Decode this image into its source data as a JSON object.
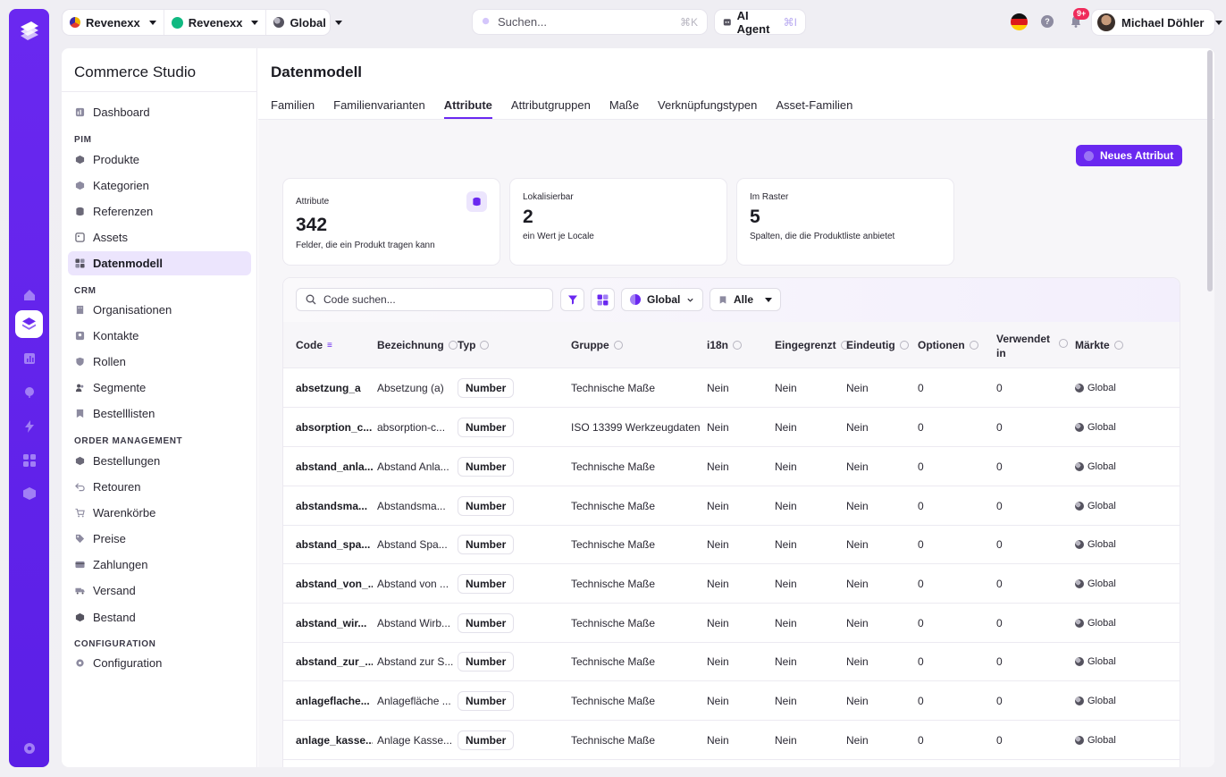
{
  "topbar": {
    "tenant1": "Revenexx",
    "tenant2": "Revenexx",
    "scope": "Global",
    "search_placeholder": "Suchen...",
    "search_shortcut": "⌘K",
    "ai_agent_label": "AI Agent",
    "ai_agent_shortcut": "⌘I",
    "help_glyph": "?",
    "notification_badge": "9+",
    "user_name": "Michael Döhler"
  },
  "sidebar": {
    "title": "Commerce Studio",
    "dashboard": "Dashboard",
    "sections": [
      {
        "title": "PIM",
        "items": [
          "Produkte",
          "Kategorien",
          "Referenzen",
          "Assets",
          "Datenmodell"
        ]
      },
      {
        "title": "CRM",
        "items": [
          "Organisationen",
          "Kontakte",
          "Rollen",
          "Segmente",
          "Bestelllisten"
        ]
      },
      {
        "title": "ORDER MANAGEMENT",
        "items": [
          "Bestellungen",
          "Retouren",
          "Warenkörbe",
          "Preise",
          "Zahlungen",
          "Versand",
          "Bestand"
        ]
      },
      {
        "title": "CONFIGURATION",
        "items": [
          "Configuration"
        ]
      }
    ],
    "active_item": "Datenmodell"
  },
  "main": {
    "title": "Datenmodell",
    "tabs": [
      "Familien",
      "Familienvarianten",
      "Attribute",
      "Attributgruppen",
      "Maße",
      "Verknüpfungstypen",
      "Asset-Familien"
    ],
    "active_tab": "Attribute",
    "new_button": "Neues Attribut",
    "cards": [
      {
        "label": "Attribute",
        "value": "342",
        "sub": "Felder, die ein Produkt tragen kann"
      },
      {
        "label": "Lokalisierbar",
        "value": "2",
        "sub": "ein Wert je Locale"
      },
      {
        "label": "Im Raster",
        "value": "5",
        "sub": "Spalten, die die Produktliste anbietet"
      }
    ],
    "filters": {
      "code_search_placeholder": "Code suchen...",
      "scope": "Global",
      "all": "Alle"
    },
    "table": {
      "headers": [
        "Code",
        "Bezeichnung",
        "Typ",
        "Gruppe",
        "i18n",
        "Eingegrenzt",
        "Eindeutig",
        "Optionen",
        "Verwendet in",
        "Märkte"
      ],
      "headers_split": {
        "used_line1": "Verwendet",
        "used_line2": "in"
      },
      "rows": [
        [
          "absetzung_a",
          "Absetzung (a)",
          "Number",
          "Technische Maße",
          "Nein",
          "Nein",
          "Nein",
          "0",
          "0",
          "Global"
        ],
        [
          "absorption_c...",
          "absorption-c...",
          "Number",
          "ISO 13399 Werkzeugdaten",
          "Nein",
          "Nein",
          "Nein",
          "0",
          "0",
          "Global"
        ],
        [
          "abstand_anla...",
          "Abstand Anla...",
          "Number",
          "Technische Maße",
          "Nein",
          "Nein",
          "Nein",
          "0",
          "0",
          "Global"
        ],
        [
          "abstandsma...",
          "Abstandsma...",
          "Number",
          "Technische Maße",
          "Nein",
          "Nein",
          "Nein",
          "0",
          "0",
          "Global"
        ],
        [
          "abstand_spa...",
          "Abstand Spa...",
          "Number",
          "Technische Maße",
          "Nein",
          "Nein",
          "Nein",
          "0",
          "0",
          "Global"
        ],
        [
          "abstand_von_...",
          "Abstand von ...",
          "Number",
          "Technische Maße",
          "Nein",
          "Nein",
          "Nein",
          "0",
          "0",
          "Global"
        ],
        [
          "abstand_wir...",
          "Abstand Wirb...",
          "Number",
          "Technische Maße",
          "Nein",
          "Nein",
          "Nein",
          "0",
          "0",
          "Global"
        ],
        [
          "abstand_zur_...",
          "Abstand zur S...",
          "Number",
          "Technische Maße",
          "Nein",
          "Nein",
          "Nein",
          "0",
          "0",
          "Global"
        ],
        [
          "anlageflache...",
          "Anlagefläche ...",
          "Number",
          "Technische Maße",
          "Nein",
          "Nein",
          "Nein",
          "0",
          "0",
          "Global"
        ],
        [
          "anlage_kasse...",
          "Anlage Kasse...",
          "Number",
          "Technische Maße",
          "Nein",
          "Nein",
          "Nein",
          "0",
          "0",
          "Global"
        ]
      ]
    }
  },
  "colors": {
    "accent": "#6a28f0",
    "rail": "#5b1fe6",
    "accent_light": "#ece5fd"
  }
}
